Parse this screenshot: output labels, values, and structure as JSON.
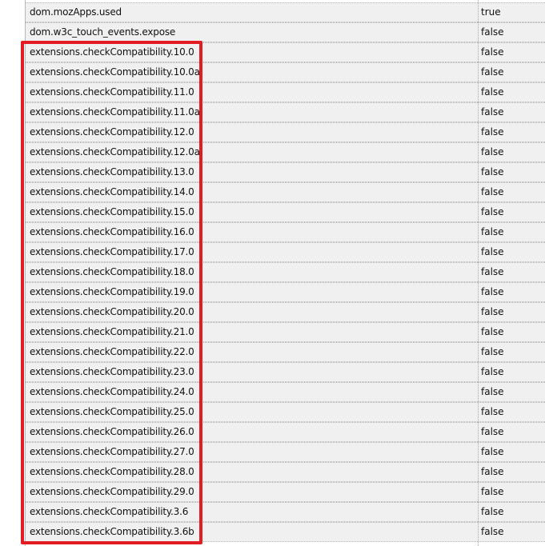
{
  "preferences": [
    {
      "name": "dom.mozApps.used",
      "value": "true"
    },
    {
      "name": "dom.w3c_touch_events.expose",
      "value": "false"
    },
    {
      "name": "extensions.checkCompatibility.10.0",
      "value": "false"
    },
    {
      "name": "extensions.checkCompatibility.10.0a",
      "value": "false"
    },
    {
      "name": "extensions.checkCompatibility.11.0",
      "value": "false"
    },
    {
      "name": "extensions.checkCompatibility.11.0a",
      "value": "false"
    },
    {
      "name": "extensions.checkCompatibility.12.0",
      "value": "false"
    },
    {
      "name": "extensions.checkCompatibility.12.0a",
      "value": "false"
    },
    {
      "name": "extensions.checkCompatibility.13.0",
      "value": "false"
    },
    {
      "name": "extensions.checkCompatibility.14.0",
      "value": "false"
    },
    {
      "name": "extensions.checkCompatibility.15.0",
      "value": "false"
    },
    {
      "name": "extensions.checkCompatibility.16.0",
      "value": "false"
    },
    {
      "name": "extensions.checkCompatibility.17.0",
      "value": "false"
    },
    {
      "name": "extensions.checkCompatibility.18.0",
      "value": "false"
    },
    {
      "name": "extensions.checkCompatibility.19.0",
      "value": "false"
    },
    {
      "name": "extensions.checkCompatibility.20.0",
      "value": "false"
    },
    {
      "name": "extensions.checkCompatibility.21.0",
      "value": "false"
    },
    {
      "name": "extensions.checkCompatibility.22.0",
      "value": "false"
    },
    {
      "name": "extensions.checkCompatibility.23.0",
      "value": "false"
    },
    {
      "name": "extensions.checkCompatibility.24.0",
      "value": "false"
    },
    {
      "name": "extensions.checkCompatibility.25.0",
      "value": "false"
    },
    {
      "name": "extensions.checkCompatibility.26.0",
      "value": "false"
    },
    {
      "name": "extensions.checkCompatibility.27.0",
      "value": "false"
    },
    {
      "name": "extensions.checkCompatibility.28.0",
      "value": "false"
    },
    {
      "name": "extensions.checkCompatibility.29.0",
      "value": "false"
    },
    {
      "name": "extensions.checkCompatibility.3.6",
      "value": "false"
    },
    {
      "name": "extensions.checkCompatibility.3.6b",
      "value": "false"
    }
  ],
  "colors": {
    "row_background": "#f0f0f0",
    "highlight_border": "#e31b23",
    "text": "#111111"
  }
}
